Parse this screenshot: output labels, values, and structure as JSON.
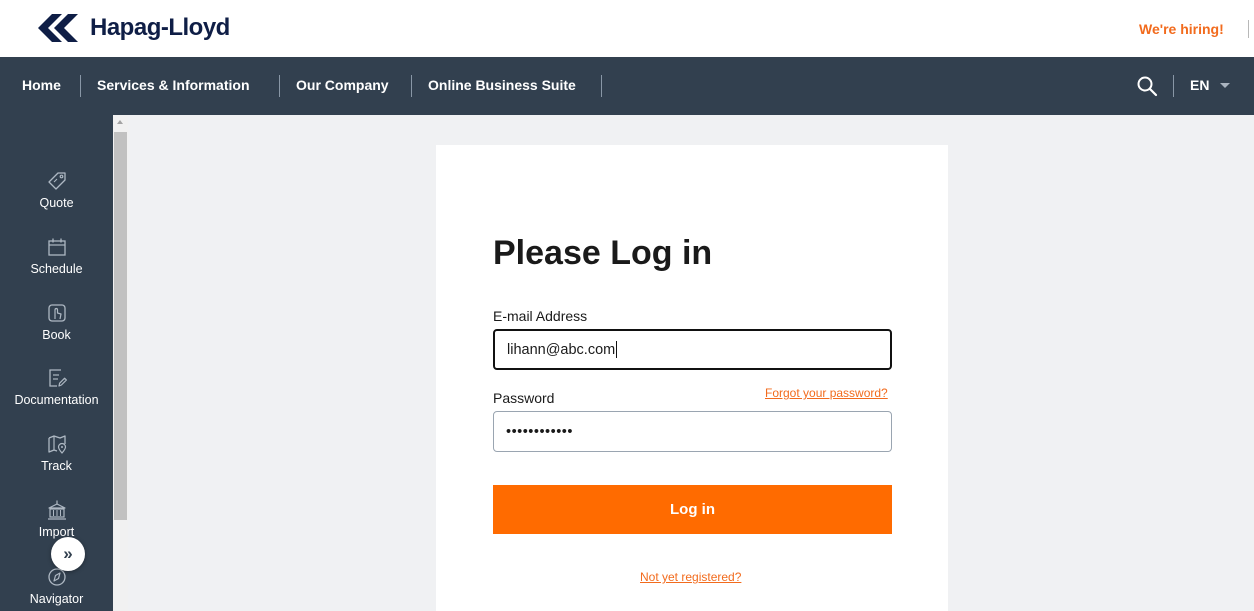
{
  "header": {
    "logo_text": "Hapag-Lloyd",
    "hiring": "We're hiring!"
  },
  "nav": {
    "items": [
      "Home",
      "Services & Information",
      "Our Company",
      "Online Business Suite"
    ],
    "language": "EN"
  },
  "sidebar": {
    "items": [
      {
        "label": "Quote",
        "icon": "tag-icon"
      },
      {
        "label": "Schedule",
        "icon": "calendar-icon"
      },
      {
        "label": "Book",
        "icon": "hand-pointer-icon"
      },
      {
        "label": "Documentation",
        "icon": "document-edit-icon"
      },
      {
        "label": "Track",
        "icon": "map-pin-icon"
      },
      {
        "label": "Import",
        "icon": "building-icon"
      },
      {
        "label": "Navigator",
        "icon": "compass-icon"
      }
    ],
    "expand_glyph": "»"
  },
  "login": {
    "title": "Please Log in",
    "email_label": "E-mail Address",
    "email_value": "lihann@abc.com",
    "password_label": "Password",
    "password_value": "••••••••••••",
    "forgot_link": "Forgot your password?",
    "submit_label": "Log in",
    "register_link": "Not yet registered?"
  },
  "colors": {
    "brand_navy": "#0f1e46",
    "nav_bg": "#32404f",
    "accent_orange": "#ff6b00",
    "link_orange": "#f26b1d",
    "content_bg": "#f0f1f3"
  }
}
